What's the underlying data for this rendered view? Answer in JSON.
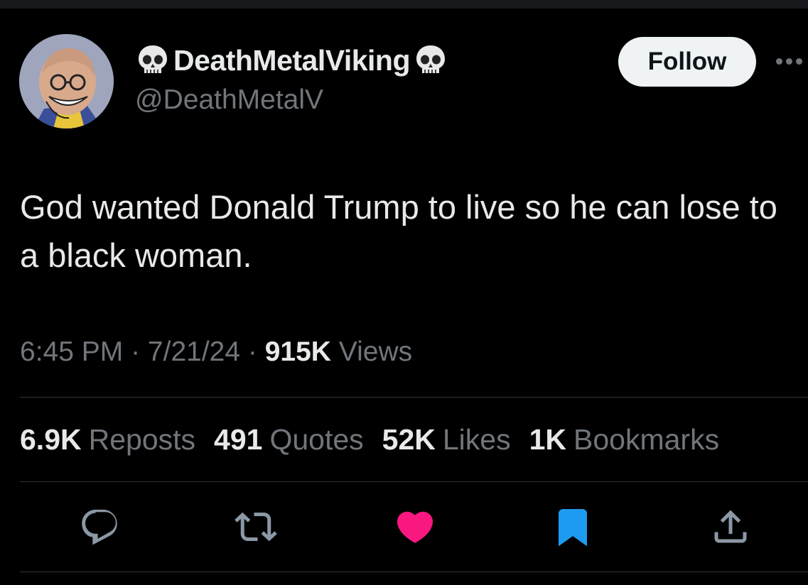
{
  "user": {
    "display_name": "DeathMetalViking",
    "handle": "@DeathMetalV",
    "name_emoji": "skull-icon"
  },
  "follow_label": "Follow",
  "tweet": {
    "text": "God wanted Donald Trump to live so he can lose to a black woman.",
    "time": "6:45 PM",
    "date": "7/21/24",
    "views_count": "915K",
    "views_label": "Views"
  },
  "stats": [
    {
      "count": "6.9K",
      "label": "Reposts"
    },
    {
      "count": "491",
      "label": "Quotes"
    },
    {
      "count": "52K",
      "label": "Likes"
    },
    {
      "count": "1K",
      "label": "Bookmarks"
    }
  ],
  "actions": [
    "reply-icon",
    "repost-icon",
    "like-icon",
    "bookmark-icon",
    "share-icon"
  ],
  "colors": {
    "background": "#000000",
    "text_primary": "#e7e9ea",
    "text_secondary": "#71767b",
    "like_active": "#f91880",
    "bookmark_active": "#1d9bf0",
    "follow_bg": "#eff3f4"
  }
}
